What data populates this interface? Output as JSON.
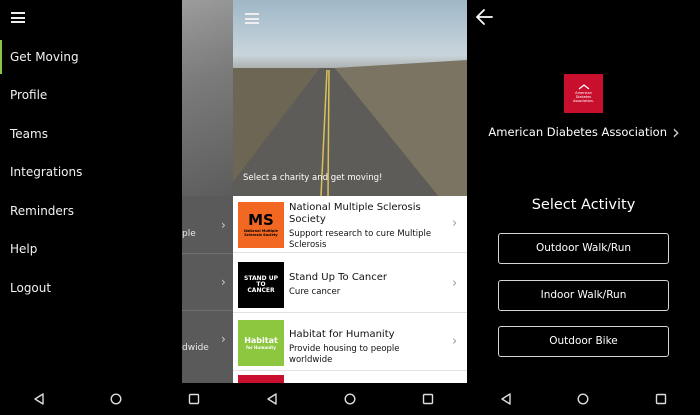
{
  "drawer": {
    "items": [
      {
        "label": "Get Moving",
        "active": true
      },
      {
        "label": "Profile"
      },
      {
        "label": "Teams"
      },
      {
        "label": "Integrations"
      },
      {
        "label": "Reminders"
      },
      {
        "label": "Help"
      },
      {
        "label": "Logout"
      }
    ]
  },
  "drawer_background": {
    "row_fragments": [
      "ple",
      "",
      "dwide"
    ]
  },
  "charities": {
    "hero_caption": "Select a charity and get moving!",
    "items": [
      {
        "title": "National Multiple Sclerosis Society",
        "description": "Support research to cure Multiple Sclerosis",
        "logo_icon": "ms-society-logo",
        "logo_main": "MS",
        "logo_sub": "National Multiple Sclerosis Society",
        "logo_color": "#f26722"
      },
      {
        "title": "Stand Up To Cancer",
        "description": "Cure cancer",
        "logo_icon": "su2c-logo",
        "logo_main": "STAND UP TO CANCER",
        "logo_sub": "",
        "logo_color": "#000000"
      },
      {
        "title": "Habitat for Humanity",
        "description": "Provide housing to people worldwide",
        "logo_icon": "habitat-logo",
        "logo_main": "Habitat",
        "logo_sub": "for Humanity",
        "logo_color": "#8dc63f"
      }
    ]
  },
  "activity": {
    "charity_name": "American Diabetes Association",
    "logo_icon": "ada-logo",
    "logo_text": "American Diabetes Association.",
    "section_title": "Select Activity",
    "buttons": [
      "Outdoor Walk/Run",
      "Indoor Walk/Run",
      "Outdoor Bike"
    ]
  },
  "colors": {
    "accent": "#8bc34a",
    "ada_red": "#c8102e"
  }
}
